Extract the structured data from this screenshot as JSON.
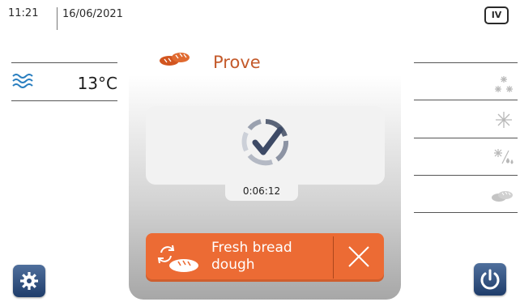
{
  "status_bar": {
    "time": "11:21",
    "date": "16/06/2021",
    "mode_badge": "IV"
  },
  "left_panel": {
    "temperature": "13°C",
    "icon": "airflow-waves-icon"
  },
  "program": {
    "title": "Prove",
    "icon": "bread-loaves-icon",
    "timer": "0:06:12",
    "status_icon": "check-complete-icon"
  },
  "action_button": {
    "line1": "Fresh bread",
    "line2": "dough",
    "icon": "bread-cycle-icon",
    "cancel_icon": "close-icon"
  },
  "right_panel": {
    "icons": [
      "deep-freeze-icon",
      "freeze-icon",
      "thaw-icon",
      "bread-icon"
    ]
  },
  "bottom": {
    "settings_icon": "gear-icon",
    "power_icon": "power-icon"
  },
  "colors": {
    "accent": "#ec6b34",
    "title": "#c45a2b",
    "button_blue": "#2c4a78",
    "wave_blue": "#2a7fc0"
  }
}
